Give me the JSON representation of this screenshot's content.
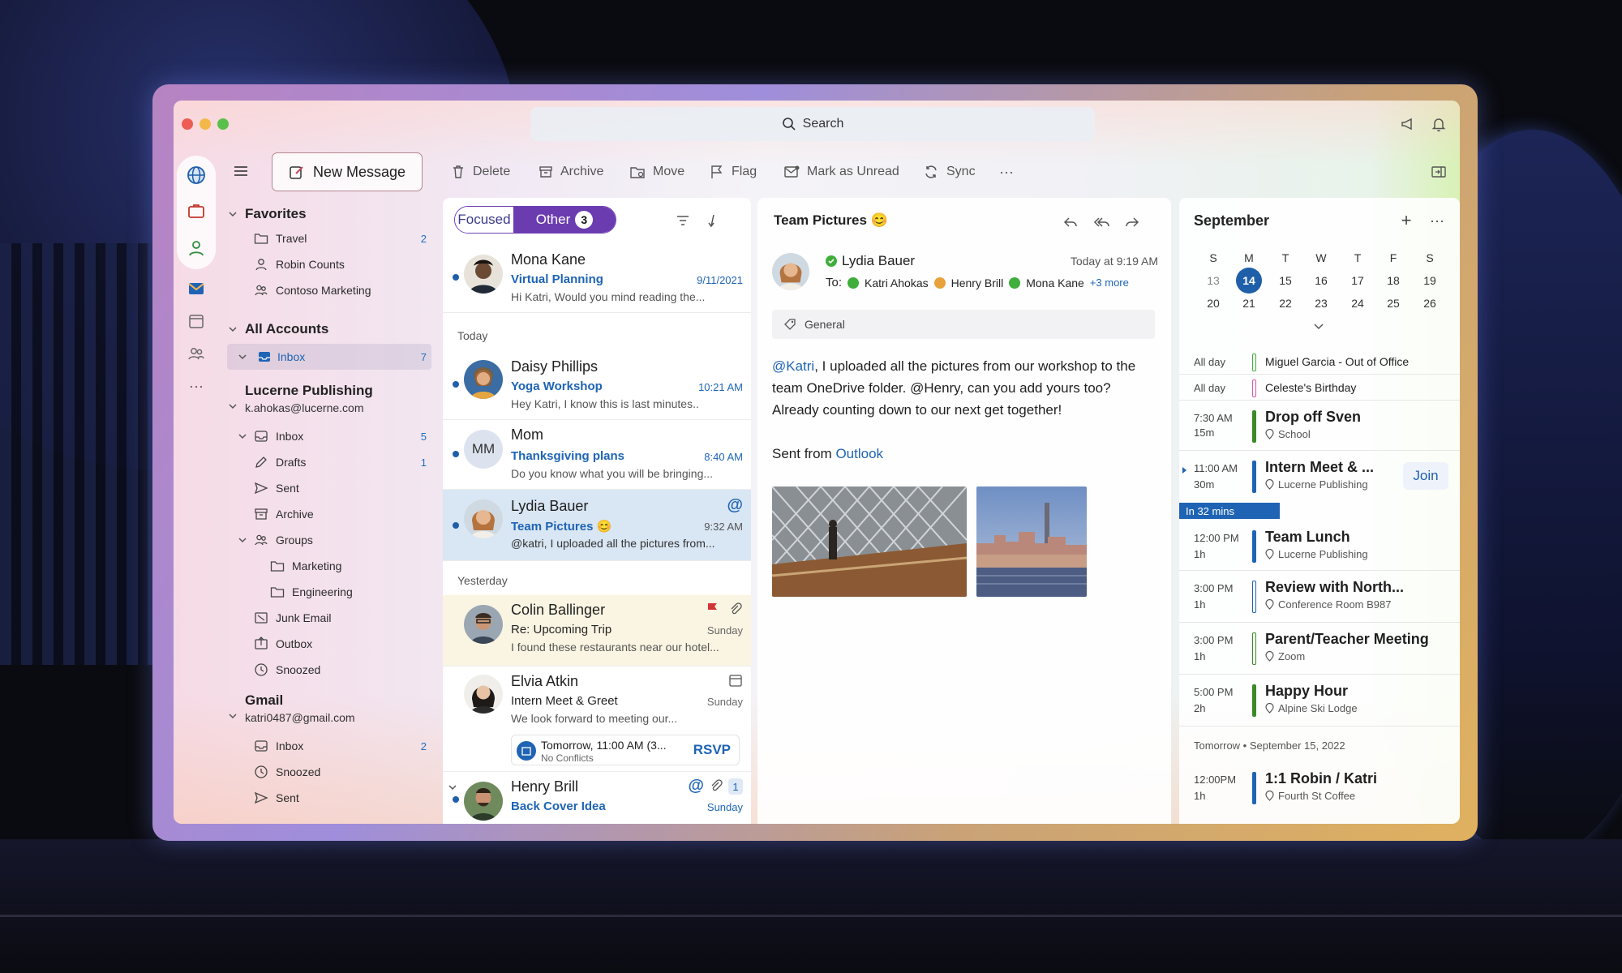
{
  "search": {
    "label": "Search"
  },
  "toolbar": {
    "new_message": "New Message",
    "delete": "Delete",
    "archive": "Archive",
    "move": "Move",
    "flag": "Flag",
    "mark_unread": "Mark as Unread",
    "sync": "Sync",
    "more": "···"
  },
  "folders": {
    "favorites": {
      "label": "Favorites",
      "items": [
        {
          "label": "Travel",
          "count": "2"
        },
        {
          "label": "Robin Counts",
          "count": ""
        },
        {
          "label": "Contoso Marketing",
          "count": ""
        }
      ]
    },
    "all_accounts": {
      "label": "All Accounts",
      "inbox": {
        "label": "Inbox",
        "count": "7"
      }
    },
    "lucerne": {
      "label": "Lucerne Publishing",
      "email": "k.ahokas@lucerne.com",
      "items": [
        {
          "label": "Inbox",
          "count": "5"
        },
        {
          "label": "Drafts",
          "count": "1"
        },
        {
          "label": "Sent",
          "count": ""
        },
        {
          "label": "Archive",
          "count": ""
        },
        {
          "label": "Groups",
          "count": ""
        },
        {
          "label": "Marketing",
          "count": ""
        },
        {
          "label": "Engineering",
          "count": ""
        },
        {
          "label": "Junk Email",
          "count": ""
        },
        {
          "label": "Outbox",
          "count": ""
        },
        {
          "label": "Snoozed",
          "count": ""
        }
      ]
    },
    "gmail": {
      "label": "Gmail",
      "email": "katri0487@gmail.com",
      "items": [
        {
          "label": "Inbox",
          "count": "2"
        },
        {
          "label": "Snoozed",
          "count": ""
        },
        {
          "label": "Sent",
          "count": ""
        }
      ]
    }
  },
  "list": {
    "focused": "Focused",
    "other": "Other",
    "other_count": "3",
    "groups": {
      "today": "Today",
      "yesterday": "Yesterday"
    },
    "messages": [
      {
        "name": "Mona Kane",
        "subject": "Virtual Planning",
        "date": "9/11/2021",
        "preview": "Hi Katri, Would you mind reading the..."
      },
      {
        "name": "Daisy Phillips",
        "subject": "Yoga Workshop",
        "date": "10:21 AM",
        "preview": "Hey Katri, I know this is last minutes.."
      },
      {
        "name": "Mom",
        "initials": "MM",
        "subject": "Thanksgiving plans",
        "date": "8:40 AM",
        "preview": "Do you know what you will be bringing..."
      },
      {
        "name": "Lydia Bauer",
        "subject": "Team Pictures 😊",
        "date": "9:32 AM",
        "preview": "@katri, I uploaded all the pictures from..."
      },
      {
        "name": "Colin Ballinger",
        "subject": "Re: Upcoming Trip",
        "date": "Sunday",
        "preview": "I found these restaurants near our hotel..."
      },
      {
        "name": "Elvia Atkin",
        "subject": "Intern Meet & Greet",
        "date": "Sunday",
        "preview": "We look forward to meeting our...",
        "invite": "Tomorrow, 11:00 AM (3...",
        "invite_sub": "No Conflicts",
        "rsvp": "RSVP"
      },
      {
        "name": "Henry Brill",
        "subject": "Back Cover Idea",
        "date": "Sunday",
        "badge": "1"
      }
    ]
  },
  "reading": {
    "subject": "Team Pictures 😊",
    "from": "Lydia Bauer",
    "time": "Today at 9:19 AM",
    "to_label": "To:",
    "recipients": [
      "Katri Ahokas",
      "Henry Brill",
      "Mona Kane"
    ],
    "more": "+3 more",
    "tag": "General",
    "mention": "@Katri",
    "body_rest": ", I uploaded all the pictures from our workshop to the team OneDrive folder. @Henry, can you add yours too? Already counting down to our next get together!",
    "sent_from": "Sent from",
    "sent_link": "Outlook"
  },
  "calendar": {
    "month": "September",
    "dow": [
      "S",
      "M",
      "T",
      "W",
      "T",
      "F",
      "S"
    ],
    "week1": [
      "13",
      "14",
      "15",
      "16",
      "17",
      "18",
      "19"
    ],
    "week2": [
      "20",
      "21",
      "22",
      "23",
      "24",
      "25",
      "26"
    ],
    "today": "14",
    "allday": [
      {
        "label": "All day",
        "title": "Miguel Garcia - Out of Office",
        "color": "#3fae3a"
      },
      {
        "label": "All day",
        "title": "Celeste's Birthday",
        "color": "#d35aa8"
      }
    ],
    "events": [
      {
        "time": "7:30 AM",
        "dur": "15m",
        "title": "Drop off Sven",
        "loc": "School",
        "color": "#3a8a2a"
      },
      {
        "time": "11:00 AM",
        "dur": "30m",
        "title": "Intern Meet & ...",
        "loc": "Lucerne Publishing",
        "color": "#1f64b4",
        "join": "Join"
      },
      {
        "time": "12:00 PM",
        "dur": "1h",
        "title": "Team Lunch",
        "loc": "Lucerne Publishing",
        "color": "#1f64b4"
      },
      {
        "time": "3:00 PM",
        "dur": "1h",
        "title": "Review with North...",
        "loc": "Conference Room B987",
        "color": "#1f64b4"
      },
      {
        "time": "3:00 PM",
        "dur": "1h",
        "title": "Parent/Teacher Meeting",
        "loc": "Zoom",
        "color": "#3a8a2a"
      },
      {
        "time": "5:00 PM",
        "dur": "2h",
        "title": "Happy Hour",
        "loc": "Alpine Ski Lodge",
        "color": "#3a8a2a"
      }
    ],
    "in_mins": "In 32 mins",
    "tomorrow": "Tomorrow • September 15, 2022",
    "tomorrow_event": {
      "time": "12:00PM",
      "dur": "1h",
      "title": "1:1 Robin / Katri",
      "loc": "Fourth St Coffee",
      "color": "#1f64b4"
    }
  }
}
